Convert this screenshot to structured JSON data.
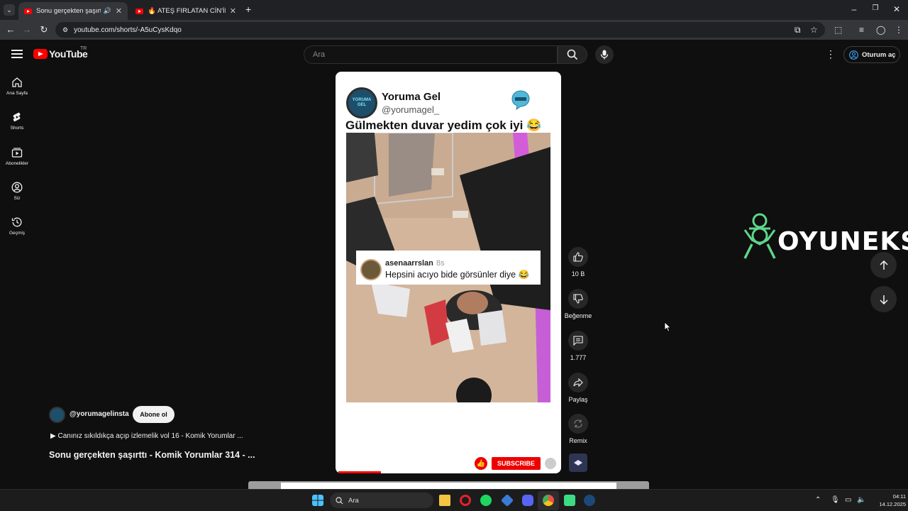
{
  "browser": {
    "tabs": [
      {
        "title": "Sonu gerçekten şaşırttı - Ko",
        "active": true
      },
      {
        "title": "🔥 ATEŞ FIRLATAN CİN'İN YAŞA",
        "active": false
      }
    ],
    "new_tab_label": "+",
    "url": "youtube.com/shorts/-A5uCysKdqo",
    "window_controls": [
      "minimize-icon",
      "restore-icon",
      "close-icon"
    ]
  },
  "youtube": {
    "logo_text": "YouTube",
    "country_code": "TR",
    "search_placeholder": "Ara",
    "signin_label": "Oturum aç",
    "sidebar": [
      {
        "label": "Ana Sayfa",
        "icon": "home-icon"
      },
      {
        "label": "Shorts",
        "icon": "shorts-icon"
      },
      {
        "label": "Abonelikler",
        "icon": "subscriptions-icon"
      },
      {
        "label": "Siz",
        "icon": "you-icon"
      },
      {
        "label": "Geçmiş",
        "icon": "history-icon"
      }
    ]
  },
  "short": {
    "tweet": {
      "name": "Yoruma Gel",
      "handle": "@yorumagel_",
      "text": "Gülmekten duvar yedim çok iyi 😂",
      "avatar_text": "YORUMA GEL"
    },
    "comment": {
      "user": "asenaarrslan",
      "time": "8s",
      "text": "Hepsini acıyo bide görsünler diye 😂"
    },
    "subscribe_label": "SUBSCRIBE",
    "progress": 0.2
  },
  "actions": {
    "like_count": "10 B",
    "dislike_label": "Beğenme",
    "comment_count": "1.777",
    "share_label": "Paylaş",
    "remix_label": "Remix"
  },
  "meta": {
    "channel": "@yorumagelinsta",
    "subscribe_label": "Abone ol",
    "playlist": "▶ Canınız sıkıldıkça açıp izlemelik vol 16 - Komik Yorumlar ...",
    "title": "Sonu gerçekten şaşırttı - Komik Yorumlar 314 - ..."
  },
  "watermark": {
    "text": "OYUNEKS"
  },
  "taskbar": {
    "search_label": "Ara",
    "time": "04:11",
    "date": "14.12.2025",
    "apps": [
      "windows-icon",
      "file-explorer-icon",
      "opera-icon",
      "spotify-icon",
      "app-icon",
      "discord-icon",
      "chrome-icon",
      "android-icon",
      "steam-icon"
    ]
  }
}
